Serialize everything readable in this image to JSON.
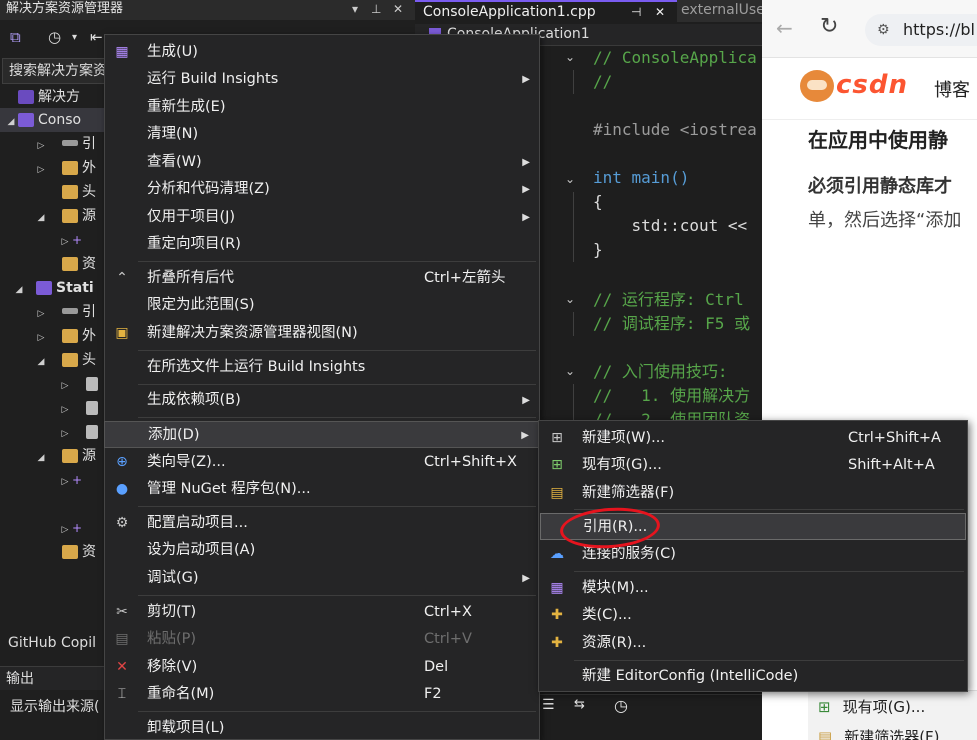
{
  "solution_explorer": {
    "title": "解决方案资源管理器",
    "search_placeholder": "搜索解决方案资源",
    "tree": {
      "solution": "解决方",
      "project1": "Conso",
      "ref1": "引",
      "ext1": "外",
      "hdr1": "头",
      "src1": "源",
      "res1": "资",
      "project2": "Stati",
      "ref2": "引",
      "ext2": "外",
      "hdr2": "头",
      "src2": "源",
      "res2": "资"
    },
    "github_copilot": "GitHub Copil",
    "output": "输出",
    "output_source": "显示输出来源("
  },
  "editor": {
    "tabs": [
      {
        "label": "ConsoleApplication1.cpp"
      },
      {
        "label": "externalUse"
      }
    ],
    "pin_icon": "pin-icon",
    "close_icon": "close-icon",
    "nav": "ConsoleApplication1",
    "lines": [
      "// ConsoleApplica",
      "//",
      "#include <iostrea",
      "int main()",
      "{",
      "    std::cout <<",
      "}",
      "// 运行程序: Ctrl",
      "// 调试程序: F5 或",
      "// 入门使用技巧:",
      "//   1. 使用解决方",
      "//   2. 使用团队资"
    ]
  },
  "browser": {
    "url": "https://bl",
    "logo": "CSDN",
    "blog": "博客",
    "heading": "在应用中使用静",
    "bold_line": "必须引用静态库才",
    "line2": "单，然后选择“添加",
    "bottom_item1": "现有项(G)...",
    "bottom_item2": "新建筛选器(F)"
  },
  "context_menu": {
    "build": "生成(U)",
    "run_build_insights": "运行 Build Insights",
    "rebuild": "重新生成(E)",
    "clean": "清理(N)",
    "view": "查看(W)",
    "analyze": "分析和代码清理(Z)",
    "project_only": "仅用于项目(J)",
    "retarget": "重定向项目(R)",
    "collapse_all": "折叠所有后代",
    "collapse_all_shortcut": "Ctrl+左箭头",
    "scope_to_this": "限定为此范围(S)",
    "new_se_view": "新建解决方案资源管理器视图(N)",
    "build_insights_selected": "在所选文件上运行 Build Insights",
    "build_dependencies": "生成依赖项(B)",
    "add": "添加(D)",
    "class_wizard": "类向导(Z)...",
    "class_wizard_shortcut": "Ctrl+Shift+X",
    "nuget": "管理 NuGet 程序包(N)...",
    "config_startup": "配置启动项目...",
    "set_startup": "设为启动项目(A)",
    "debug": "调试(G)",
    "cut": "剪切(T)",
    "cut_shortcut": "Ctrl+X",
    "paste": "粘贴(P)",
    "paste_shortcut": "Ctrl+V",
    "remove": "移除(V)",
    "remove_shortcut": "Del",
    "rename": "重命名(M)",
    "rename_shortcut": "F2",
    "unload": "卸载项目(L)"
  },
  "add_submenu": {
    "new_item": "新建项(W)...",
    "new_item_shortcut": "Ctrl+Shift+A",
    "existing_item": "现有项(G)...",
    "existing_item_shortcut": "Shift+Alt+A",
    "new_filter": "新建筛选器(F)",
    "reference": "引用(R)...",
    "connected_service": "连接的服务(C)",
    "module": "模块(M)...",
    "class": "类(C)...",
    "resource": "资源(R)...",
    "new_editorconfig": "新建 EditorConfig (IntelliCode)"
  },
  "colors": {
    "annotation_circle": "#e6141e",
    "csdn_brand": "#fc5531",
    "accent": "#7a5cf0"
  }
}
